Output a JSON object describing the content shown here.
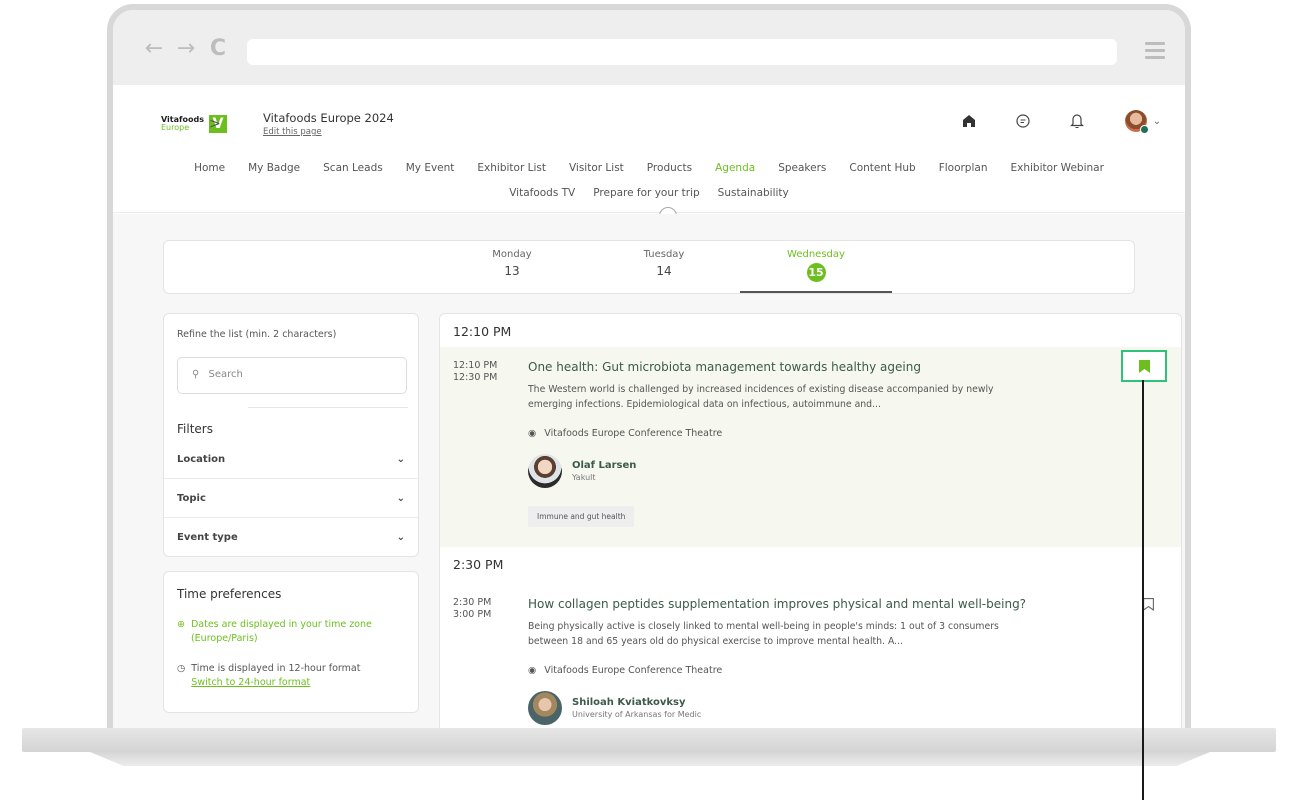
{
  "browser": {
    "url": ""
  },
  "header": {
    "logo_brand": "Vitafoods",
    "logo_region": "Europe",
    "logo_letter": "V",
    "event_title": "Vitafoods Europe 2024",
    "edit_link": "Edit this page"
  },
  "nav": {
    "row1": [
      "Home",
      "My Badge",
      "Scan Leads",
      "My Event",
      "Exhibitor List",
      "Visitor List",
      "Products",
      "Agenda",
      "Speakers",
      "Content Hub",
      "Floorplan",
      "Exhibitor Webinar"
    ],
    "row2": [
      "Vitafoods TV",
      "Prepare for your trip",
      "Sustainability"
    ],
    "active": "Agenda"
  },
  "days": [
    {
      "day": "Monday",
      "num": "13"
    },
    {
      "day": "Tuesday",
      "num": "14"
    },
    {
      "day": "Wednesday",
      "num": "15"
    }
  ],
  "sidebar": {
    "refine_label": "Refine the list (min. 2 characters)",
    "search_placeholder": "Search",
    "filters_title": "Filters",
    "filters": [
      "Location",
      "Topic",
      "Event type"
    ],
    "time_title": "Time preferences",
    "timezone_text": "Dates are displayed in your time zone (Europe/Paris)",
    "hour_format_text": "Time is displayed in 12-hour format",
    "switch_link": "Switch to 24-hour format"
  },
  "agenda": {
    "slots": [
      {
        "slot_time": "12:10 PM",
        "start": "12:10 PM",
        "end": "12:30 PM",
        "title": "One health: Gut microbiota management towards healthy ageing",
        "description": "The Western world is challenged by increased incidences of existing disease accompanied by newly emerging infections. Epidemiological data on infectious, autoimmune and...",
        "location": "Vitafoods Europe Conference Theatre",
        "speaker_name": "Olaf Larsen",
        "speaker_org": "Yakult",
        "tag": "Immune and gut health"
      },
      {
        "slot_time": "2:30 PM",
        "start": "2:30 PM",
        "end": "3:00 PM",
        "title": "How collagen peptides supplementation improves physical and mental well-being?",
        "description": "Being physically active is closely linked to mental well-being in people's minds: 1 out of 3 consumers between 18 and 65 years old do physical exercise to improve mental health. A...",
        "location": "Vitafoods Europe Conference Theatre",
        "speaker_name": "Shiloah Kviatkovksy",
        "speaker_org": "University of Arkansas for Medic"
      }
    ]
  },
  "colors": {
    "accent": "#6dbf1f",
    "callout": "#30c27c"
  }
}
